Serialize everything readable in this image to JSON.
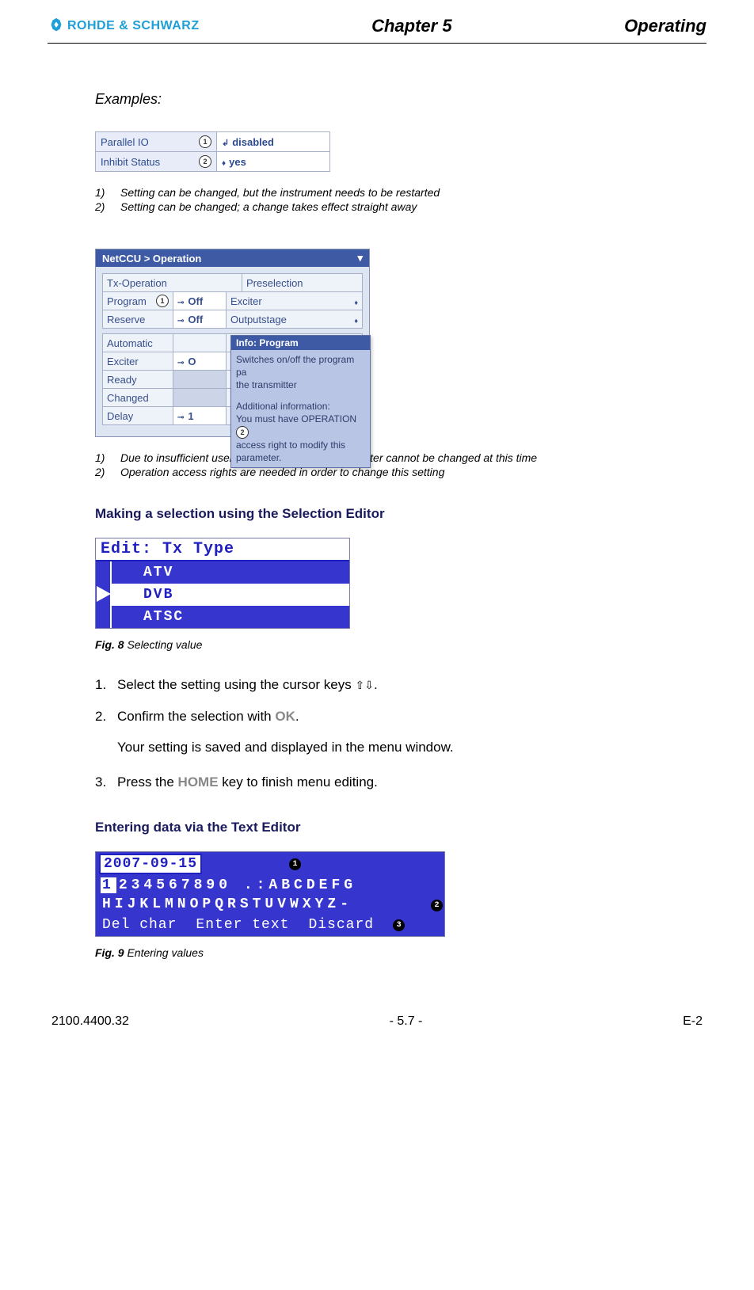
{
  "header": {
    "brand": "ROHDE & SCHWARZ",
    "chapter": "Chapter 5",
    "section": "Operating"
  },
  "examples_label": "Examples:",
  "box1": {
    "row1_label": "Parallel IO",
    "row1_badge": "1",
    "row1_value": "disabled",
    "row2_label": "Inhibit Status",
    "row2_badge": "2",
    "row2_value": "yes"
  },
  "notes1": {
    "n1_num": "1)",
    "n1_text": "Setting can be changed, but the instrument needs to be restarted",
    "n2_num": "2)",
    "n2_text": "Setting can be changed; a change takes effect straight away"
  },
  "box2": {
    "title": "NetCCU  > Operation",
    "r1_left": "Tx-Operation",
    "r1_right": "Preselection",
    "r2_left": "Program",
    "r2_badge": "1",
    "r2_mid": "Off",
    "r2_right": "Exciter",
    "r3_left": "Reserve",
    "r3_mid": "Off",
    "r3_right": "Outputstage",
    "r4_left": "Automatic",
    "r5_left": "Exciter",
    "r5_mid": "O",
    "r6_left": "Ready",
    "r7_left": "Changed",
    "r8_left": "Delay",
    "r8_mid": "1",
    "tooltip_title": "Info: Program",
    "tooltip_line1": "Switches on/off the program pa",
    "tooltip_line2": "the transmitter",
    "tooltip_line3": "Additional information:",
    "tooltip_line4a": "You must have OPERATION",
    "tooltip_badge": "2",
    "tooltip_line5": "access right to modify this",
    "tooltip_line6": "parameter."
  },
  "notes2": {
    "n1_num": "1)",
    "n1_text": "Due to insufficient user rights, the selected parameter cannot be changed at this time",
    "n2_num": "2)",
    "n2_text": "Operation access rights are needed in order to change this setting"
  },
  "section1_title": "Making a selection using the Selection Editor",
  "fig8": {
    "header": "Edit: Tx Type",
    "item1": "ATV",
    "item2": "DVB",
    "item3": "ATSC",
    "caption_prefix": "Fig. 8",
    "caption_text": "  Selecting value"
  },
  "steps": {
    "s1_num": "1.",
    "s1_text_a": "Select the setting using the cursor keys ",
    "s1_arrows": "⇧⇩",
    "s1_text_b": ".",
    "s2_num": "2.",
    "s2_text_a": "Confirm the selection with ",
    "s2_key": "OK",
    "s2_text_b": ".",
    "s2_sub": "Your setting is saved and displayed in the menu window.",
    "s3_num": "3.",
    "s3_text_a": "Press the ",
    "s3_key": "HOME",
    "s3_text_b": " key to finish menu editing."
  },
  "section2_title": "Entering data via the Text Editor",
  "fig9": {
    "date": "2007-09-15",
    "badge1": "1",
    "row1_sel": "1",
    "row1_rest": "234567890 .:ABCDEFG",
    "row2": "HIJKLMNOPQRSTUVWXYZ-",
    "badge2": "2",
    "action1": "Del char",
    "action2": "Enter text",
    "action3": "Discard",
    "badge3": "3",
    "caption_prefix": "Fig. 9",
    "caption_text": "  Entering values"
  },
  "footer": {
    "left": "2100.4400.32",
    "center": "- 5.7 -",
    "right": "E-2"
  }
}
